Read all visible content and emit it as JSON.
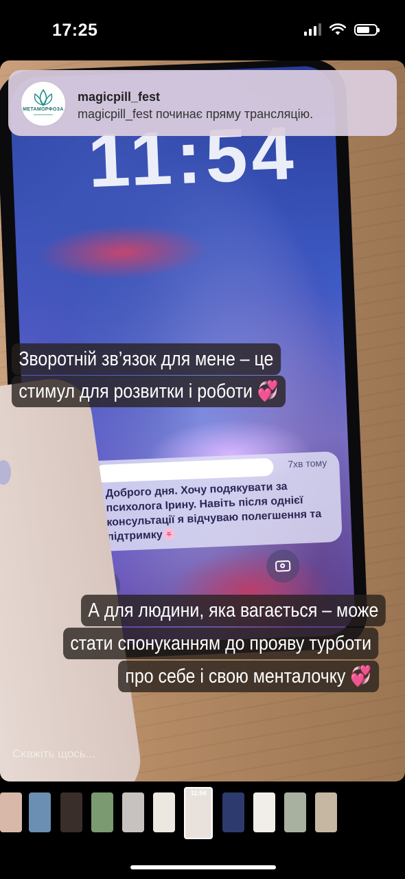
{
  "status_bar": {
    "time": "17:25",
    "signal_icon": "cellular-signal-icon",
    "wifi_icon": "wifi-icon",
    "battery_icon": "battery-icon"
  },
  "notification_banner": {
    "app_logo_text": "МЕТАМОРФОЗА",
    "title": "magicpill_fest",
    "body": "magicpill_fest починає пряму трансляцію."
  },
  "story": {
    "lock_screen": {
      "clock": "11:54",
      "notification_time": "7хв тому",
      "notification_text": "Доброго дня. Хочу подякувати за психолога Ірину. Навіть після однієї консультації я відчуваю полегшення та підтримку🌸",
      "flashlight_icon": "flashlight-icon",
      "camera_icon": "camera-icon"
    },
    "captions": {
      "first_line1": "Зворотній зв’язок для мене – це",
      "first_line2": "стимул для розвитки і роботи",
      "second_line1": "А для людини, яка вагається – може",
      "second_line2": "стати спонуканням до прояву турботи",
      "second_line3": "про себе і свою менталочку",
      "heart_emoji": "💞"
    },
    "reply_placeholder": "Скажіть щось..."
  },
  "thumbnails": {
    "active_label": "11:54",
    "colors": [
      "#d8b8a8",
      "#6b8fb3",
      "#3a2e2a",
      "#7b9a72",
      "#c7c2bf",
      "#ece7e1",
      "#e9e2dc",
      "#2c3a6e",
      "#f1eee9",
      "#a8b0a0",
      "#c6b7a3"
    ]
  }
}
